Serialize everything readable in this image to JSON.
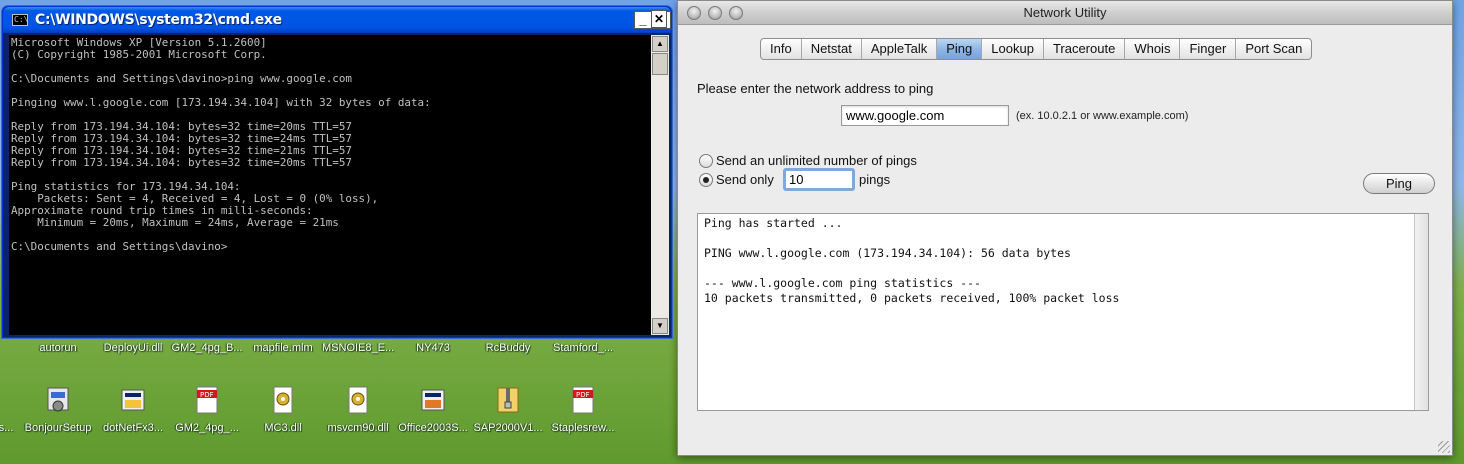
{
  "desktop": {
    "top_row_labels": [
      "autorun",
      "DeployUi.dll",
      "GM2_4pg_B...",
      "mapfile.mlm",
      "MSNOIE8_E...",
      "NY473",
      "RcBuddy",
      "Stamford_..."
    ],
    "icons": [
      {
        "label": "s...",
        "icon": "generic-icon"
      },
      {
        "label": "BonjourSetup",
        "icon": "installer-icon"
      },
      {
        "label": "dotNetFx3...",
        "icon": "installer-icon"
      },
      {
        "label": "GM2_4pg_...",
        "icon": "pdf-icon"
      },
      {
        "label": "MC3.dll",
        "icon": "dll-icon"
      },
      {
        "label": "msvcm90.dll",
        "icon": "dll-icon"
      },
      {
        "label": "Office2003S...",
        "icon": "installer-icon"
      },
      {
        "label": "SAP2000V1...",
        "icon": "zip-icon"
      },
      {
        "label": "Staplesrew...",
        "icon": "pdf-icon"
      }
    ]
  },
  "cmd": {
    "title": "C:\\WINDOWS\\system32\\cmd.exe",
    "buttons": {
      "minimize": "_",
      "maximize": "□",
      "close": "✕"
    },
    "console_lines": [
      "Microsoft Windows XP [Version 5.1.2600]",
      "(C) Copyright 1985-2001 Microsoft Corp.",
      "",
      "C:\\Documents and Settings\\davino>ping www.google.com",
      "",
      "Pinging www.l.google.com [173.194.34.104] with 32 bytes of data:",
      "",
      "Reply from 173.194.34.104: bytes=32 time=20ms TTL=57",
      "Reply from 173.194.34.104: bytes=32 time=24ms TTL=57",
      "Reply from 173.194.34.104: bytes=32 time=21ms TTL=57",
      "Reply from 173.194.34.104: bytes=32 time=20ms TTL=57",
      "",
      "Ping statistics for 173.194.34.104:",
      "    Packets: Sent = 4, Received = 4, Lost = 0 (0% loss),",
      "Approximate round trip times in milli-seconds:",
      "    Minimum = 20ms, Maximum = 24ms, Average = 21ms",
      "",
      "C:\\Documents and Settings\\davino>"
    ]
  },
  "network_utility": {
    "title": "Network Utility",
    "tabs": [
      {
        "label": "Info",
        "selected": false
      },
      {
        "label": "Netstat",
        "selected": false
      },
      {
        "label": "AppleTalk",
        "selected": false
      },
      {
        "label": "Ping",
        "selected": true
      },
      {
        "label": "Lookup",
        "selected": false
      },
      {
        "label": "Traceroute",
        "selected": false
      },
      {
        "label": "Whois",
        "selected": false
      },
      {
        "label": "Finger",
        "selected": false
      },
      {
        "label": "Port Scan",
        "selected": false
      }
    ],
    "prompt": "Please enter the network address to ping",
    "address_value": "www.google.com",
    "address_hint": "(ex. 10.0.2.1 or www.example.com)",
    "option_unlimited": "Send an unlimited number of pings",
    "option_limited": "Send only",
    "ping_count_value": "10",
    "pings_suffix": "pings",
    "selected_option": "limited",
    "ping_button": "Ping",
    "output_lines": [
      "Ping has started ...",
      "",
      "PING www.l.google.com (173.194.34.104): 56 data bytes",
      "",
      "--- www.l.google.com ping statistics ---",
      "10 packets transmitted, 0 packets received, 100% packet loss"
    ]
  },
  "colors": {
    "cmd_title_bar": "#0054e3",
    "cmd_text": "#c0c0c0",
    "selected_tab": "#8fb6e4",
    "mac_window_bg": "#ececec"
  }
}
